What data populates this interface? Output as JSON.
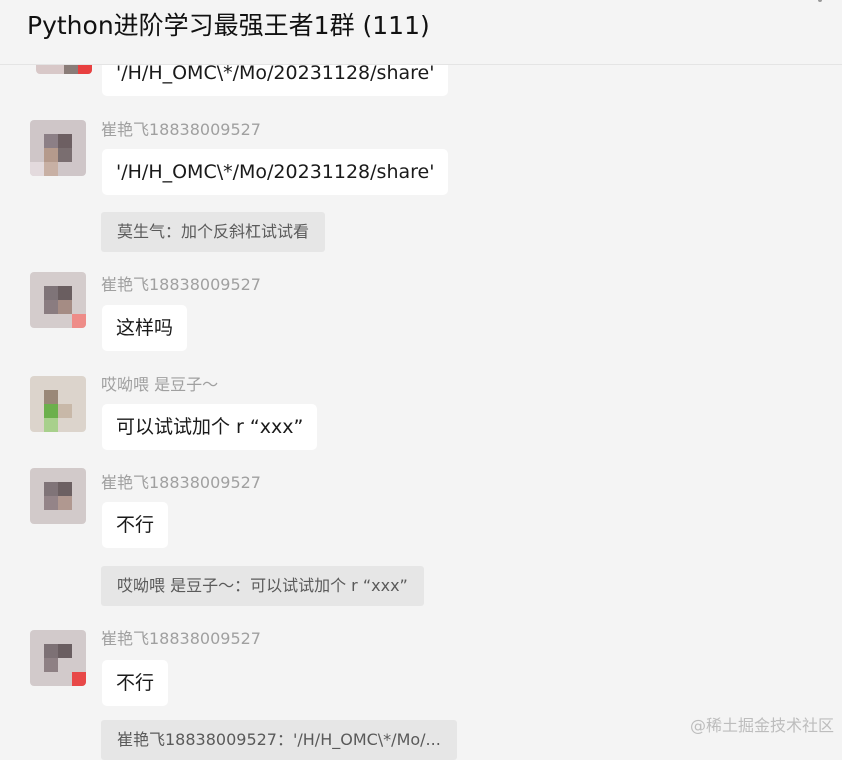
{
  "header": {
    "title": "Python进阶学习最强王者1群 (111)"
  },
  "messages": [
    {
      "sender": "",
      "text": "'/H/H_OMC\\*/Mo/20231128/share'"
    },
    {
      "sender": "崔艳飞18838009527",
      "text": "'/H/H_OMC\\*/Mo/20231128/share'"
    },
    {
      "quote": "莫生气：加个反斜杠试试看"
    },
    {
      "sender": "崔艳飞18838009527",
      "text": "这样吗"
    },
    {
      "sender": "哎呦喂  是豆子～",
      "text": "可以试试加个  r “xxx”"
    },
    {
      "sender": "崔艳飞18838009527",
      "text": "不行"
    },
    {
      "quote": "哎呦喂  是豆子～：可以试试加个  r “xxx”"
    },
    {
      "sender": "崔艳飞18838009527",
      "text": "不行"
    },
    {
      "quote": "崔艳飞18838009527：'/H/H_OMC\\*/Mo/..."
    }
  ],
  "watermark": "@稀土掘金技术社区"
}
